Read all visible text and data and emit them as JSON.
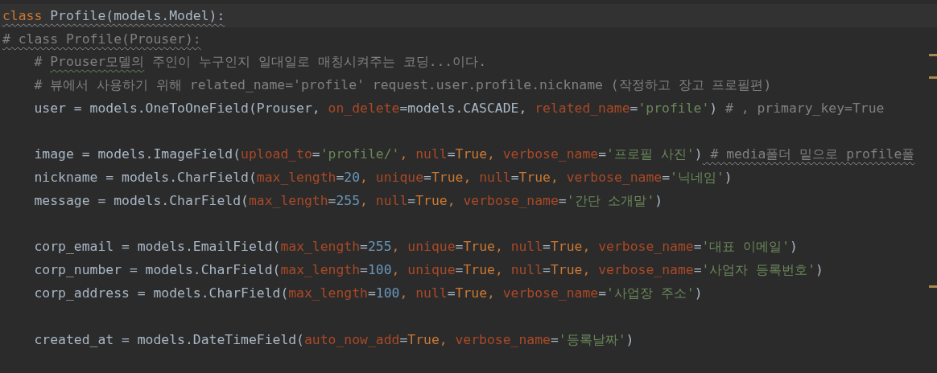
{
  "editor": {
    "lines": [
      {
        "current": true,
        "segments": [
          {
            "kind": "keyword",
            "text": "class",
            "squiggle": true
          },
          {
            "kind": "plain",
            "text": " Profile(models.Model):",
            "squiggle": true
          }
        ]
      },
      {
        "segments": [
          {
            "kind": "comment",
            "text": "# class Profile(Prouser):",
            "squiggle": true
          }
        ]
      },
      {
        "gutter_mark": true,
        "segments": [
          {
            "kind": "comment",
            "text": "    # "
          },
          {
            "kind": "comment",
            "text": "Prouser모델의",
            "typo": true
          },
          {
            "kind": "comment",
            "text": " 주인이 누구인지 일대일로 매칭시켜주는 코딩...이다."
          }
        ]
      },
      {
        "gutter_mark": true,
        "segments": [
          {
            "kind": "comment",
            "text": "    # 뷰에서 사용하기 위해 related_name='profile' request.user.profile.nickname (작정하고 장고 프로필편)"
          }
        ]
      },
      {
        "segments": [
          {
            "kind": "plain",
            "text": "    user = models.OneToOneField(Prouser, "
          },
          {
            "kind": "param",
            "text": "on_delete"
          },
          {
            "kind": "plain",
            "text": "=models.CASCADE, "
          },
          {
            "kind": "param",
            "text": "related_name"
          },
          {
            "kind": "plain",
            "text": "="
          },
          {
            "kind": "string",
            "text": "'profile'"
          },
          {
            "kind": "plain",
            "text": ")"
          },
          {
            "kind": "comment",
            "text": " # , primary_key=True"
          }
        ]
      },
      {
        "kind": "blank"
      },
      {
        "segments": [
          {
            "kind": "plain",
            "text": "    image = models.ImageField("
          },
          {
            "kind": "param",
            "text": "upload_to"
          },
          {
            "kind": "plain",
            "text": "="
          },
          {
            "kind": "string",
            "text": "'profile/'"
          },
          {
            "kind": "keyword",
            "text": ", "
          },
          {
            "kind": "param",
            "text": "null"
          },
          {
            "kind": "plain",
            "text": "="
          },
          {
            "kind": "keyword",
            "text": "True, "
          },
          {
            "kind": "param",
            "text": "verbose_name"
          },
          {
            "kind": "plain",
            "text": "="
          },
          {
            "kind": "string",
            "text": "'프로필 사진'"
          },
          {
            "kind": "plain",
            "text": ")"
          },
          {
            "kind": "comment",
            "text": " # media폴더 밑으로 profile폴",
            "squiggle": true
          }
        ]
      },
      {
        "segments": [
          {
            "kind": "plain",
            "text": "    nickname = models.CharField("
          },
          {
            "kind": "param",
            "text": "max_length"
          },
          {
            "kind": "plain",
            "text": "="
          },
          {
            "kind": "number",
            "text": "20"
          },
          {
            "kind": "keyword",
            "text": ", "
          },
          {
            "kind": "param",
            "text": "unique"
          },
          {
            "kind": "plain",
            "text": "="
          },
          {
            "kind": "keyword",
            "text": "True, "
          },
          {
            "kind": "param",
            "text": "null"
          },
          {
            "kind": "plain",
            "text": "="
          },
          {
            "kind": "keyword",
            "text": "True, "
          },
          {
            "kind": "param",
            "text": "verbose_name"
          },
          {
            "kind": "plain",
            "text": "="
          },
          {
            "kind": "string",
            "text": "'닉네임'"
          },
          {
            "kind": "plain",
            "text": ")"
          }
        ]
      },
      {
        "segments": [
          {
            "kind": "plain",
            "text": "    message = models.CharField("
          },
          {
            "kind": "param",
            "text": "max_length"
          },
          {
            "kind": "plain",
            "text": "="
          },
          {
            "kind": "number",
            "text": "255"
          },
          {
            "kind": "keyword",
            "text": ", "
          },
          {
            "kind": "param",
            "text": "null"
          },
          {
            "kind": "plain",
            "text": "="
          },
          {
            "kind": "keyword",
            "text": "True, "
          },
          {
            "kind": "param",
            "text": "verbose_name"
          },
          {
            "kind": "plain",
            "text": "="
          },
          {
            "kind": "string",
            "text": "'간단 소개말'"
          },
          {
            "kind": "plain",
            "text": ")"
          }
        ]
      },
      {
        "kind": "blank"
      },
      {
        "segments": [
          {
            "kind": "plain",
            "text": "    corp_email = models.EmailField("
          },
          {
            "kind": "param",
            "text": "max_length"
          },
          {
            "kind": "plain",
            "text": "="
          },
          {
            "kind": "number",
            "text": "255"
          },
          {
            "kind": "keyword",
            "text": ", "
          },
          {
            "kind": "param",
            "text": "unique"
          },
          {
            "kind": "plain",
            "text": "="
          },
          {
            "kind": "keyword",
            "text": "True, "
          },
          {
            "kind": "param",
            "text": "null"
          },
          {
            "kind": "plain",
            "text": "="
          },
          {
            "kind": "keyword",
            "text": "True, "
          },
          {
            "kind": "param",
            "text": "verbose_name"
          },
          {
            "kind": "plain",
            "text": "="
          },
          {
            "kind": "string",
            "text": "'대표 이메일'"
          },
          {
            "kind": "plain",
            "text": ")"
          }
        ]
      },
      {
        "segments": [
          {
            "kind": "plain",
            "text": "    corp_number = models.CharField("
          },
          {
            "kind": "param",
            "text": "max_length"
          },
          {
            "kind": "plain",
            "text": "="
          },
          {
            "kind": "number",
            "text": "100"
          },
          {
            "kind": "keyword",
            "text": ", "
          },
          {
            "kind": "param",
            "text": "unique"
          },
          {
            "kind": "plain",
            "text": "="
          },
          {
            "kind": "keyword",
            "text": "True, "
          },
          {
            "kind": "param",
            "text": "null"
          },
          {
            "kind": "plain",
            "text": "="
          },
          {
            "kind": "keyword",
            "text": "True, "
          },
          {
            "kind": "param",
            "text": "verbose_name"
          },
          {
            "kind": "plain",
            "text": "="
          },
          {
            "kind": "string",
            "text": "'사업자 등록번호'"
          },
          {
            "kind": "plain",
            "text": ")"
          }
        ]
      },
      {
        "gutter_mark": true,
        "segments": [
          {
            "kind": "plain",
            "text": "    corp_address = models.CharField("
          },
          {
            "kind": "param",
            "text": "max_length"
          },
          {
            "kind": "plain",
            "text": "="
          },
          {
            "kind": "number",
            "text": "100"
          },
          {
            "kind": "keyword",
            "text": ", "
          },
          {
            "kind": "param",
            "text": "null"
          },
          {
            "kind": "plain",
            "text": "="
          },
          {
            "kind": "keyword",
            "text": "True, "
          },
          {
            "kind": "param",
            "text": "verbose_name"
          },
          {
            "kind": "plain",
            "text": "="
          },
          {
            "kind": "string",
            "text": "'사업장 주소'"
          },
          {
            "kind": "plain",
            "text": ")"
          }
        ]
      },
      {
        "kind": "blank"
      },
      {
        "segments": [
          {
            "kind": "plain",
            "text": "    created_at = models.DateTimeField("
          },
          {
            "kind": "param",
            "text": "auto_now_add"
          },
          {
            "kind": "plain",
            "text": "="
          },
          {
            "kind": "keyword",
            "text": "True, "
          },
          {
            "kind": "param",
            "text": "verbose_name"
          },
          {
            "kind": "plain",
            "text": "="
          },
          {
            "kind": "string",
            "text": "'등록날짜'"
          },
          {
            "kind": "plain",
            "text": ")"
          }
        ]
      }
    ]
  }
}
